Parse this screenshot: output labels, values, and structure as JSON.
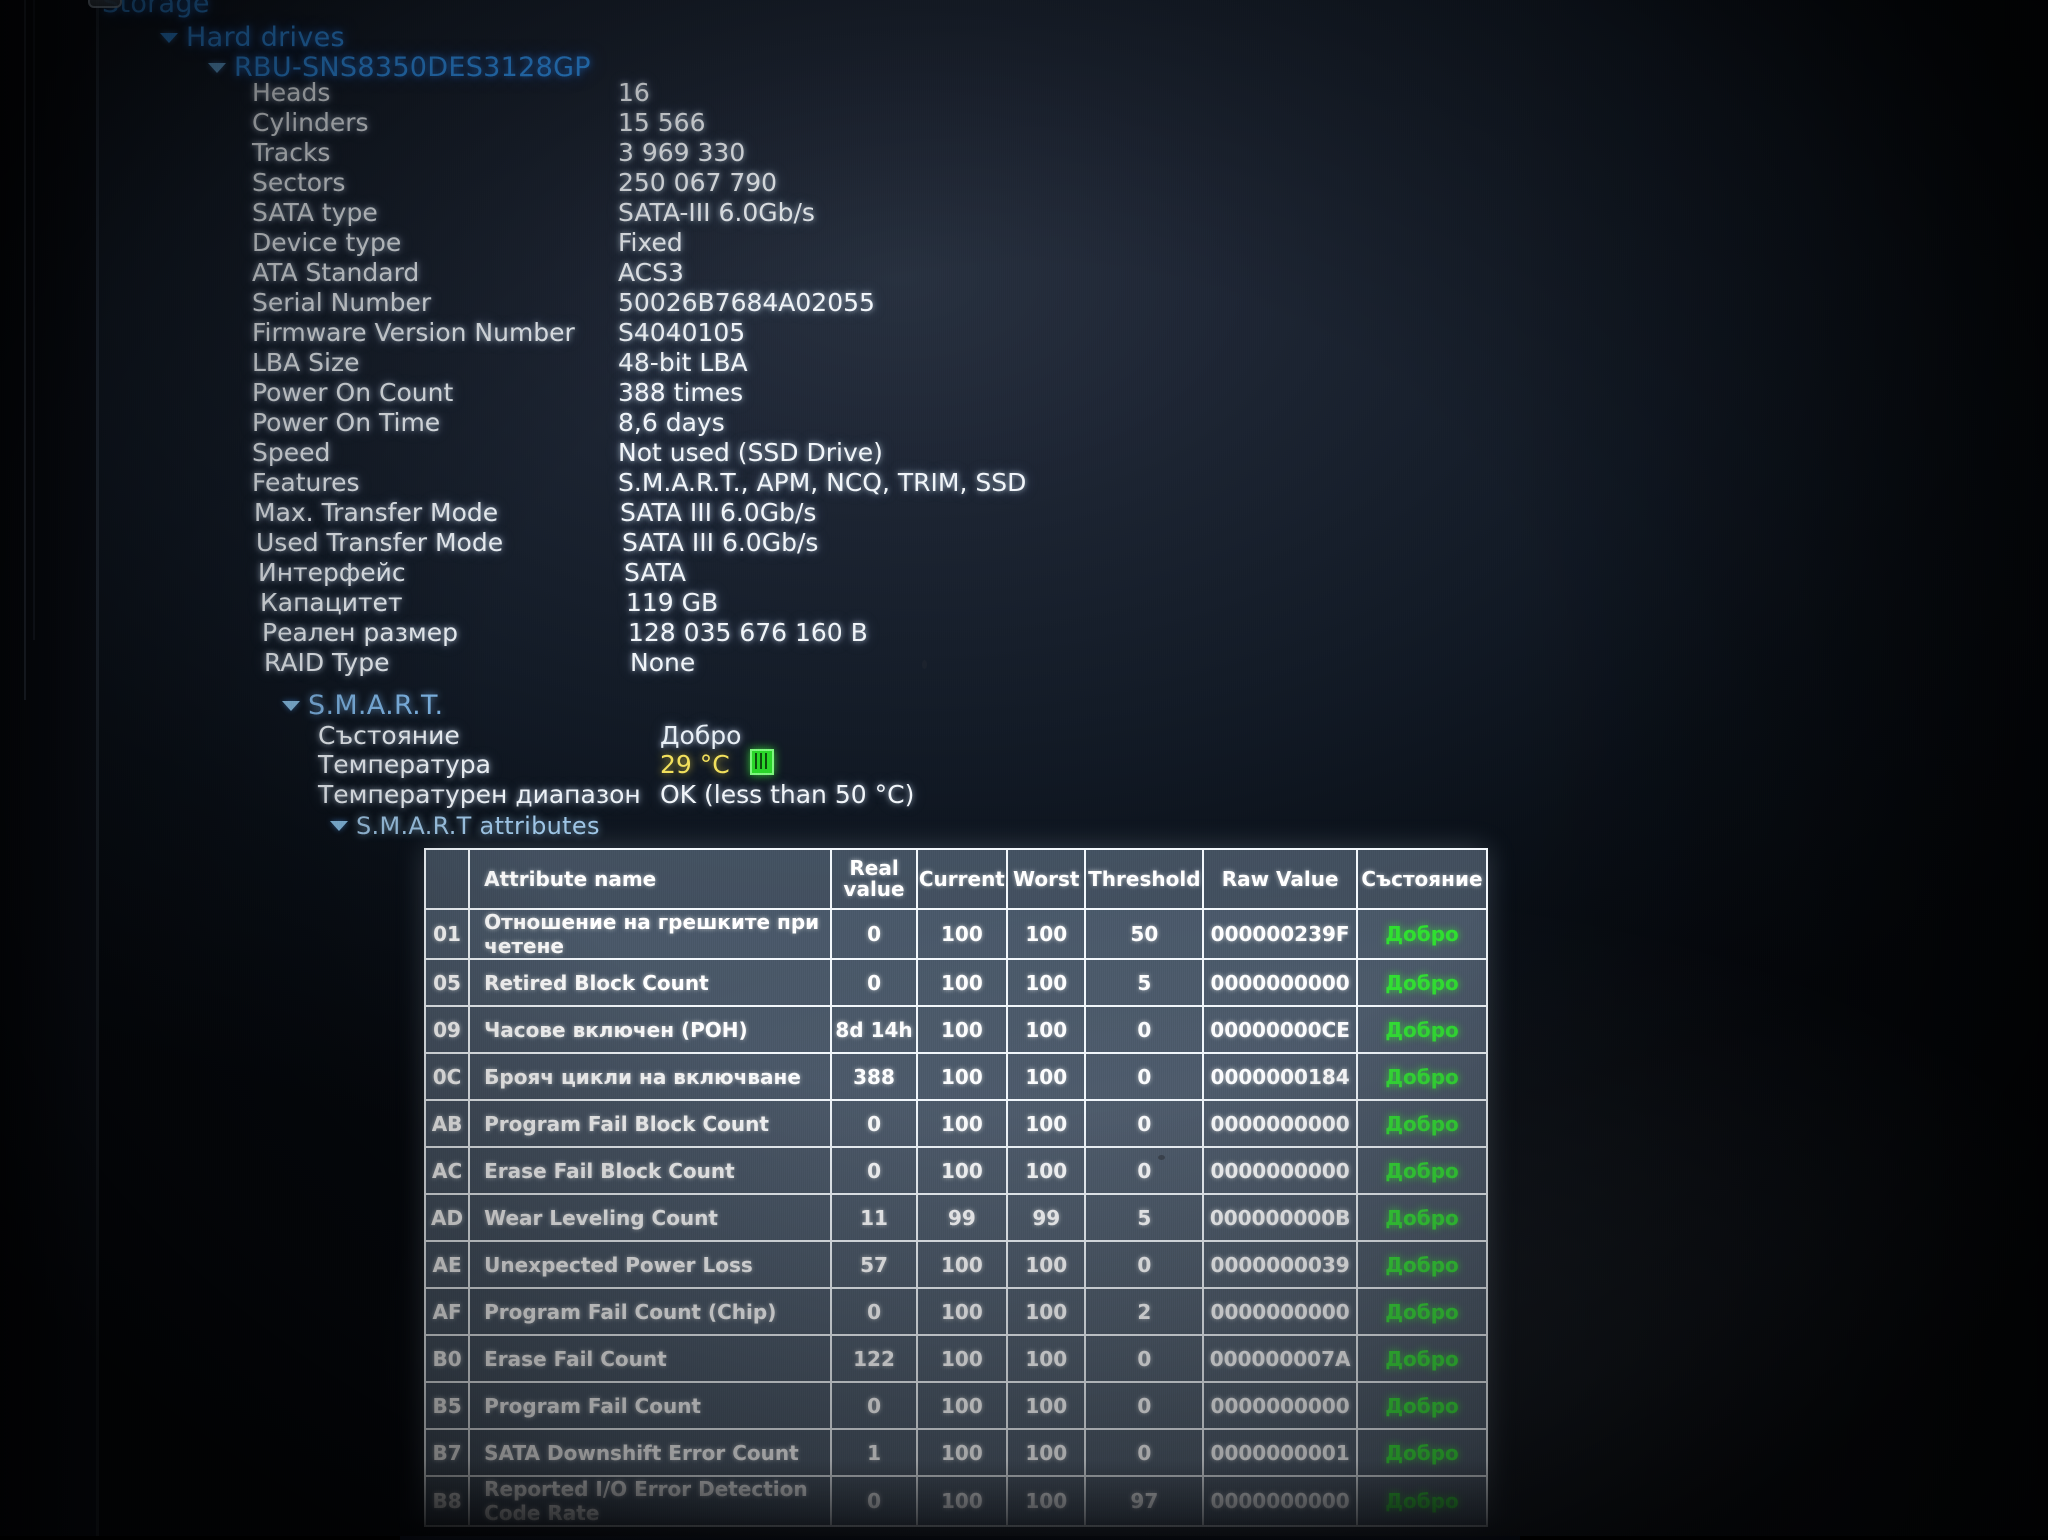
{
  "tree": {
    "root_label": "Storage",
    "root_icon": "hard-drive-icon",
    "hard_drives_label": "Hard drives",
    "device_label": "RBU-SNS8350DES3128GP",
    "smart_label": "S.M.A.R.T.",
    "smart_attributes_label": "S.M.A.R.T attributes"
  },
  "device_properties": [
    {
      "key": "Heads",
      "value": "16"
    },
    {
      "key": "Cylinders",
      "value": "15 566"
    },
    {
      "key": "Tracks",
      "value": "3 969 330"
    },
    {
      "key": "Sectors",
      "value": "250 067 790"
    },
    {
      "key": "SATA type",
      "value": "SATA-III 6.0Gb/s"
    },
    {
      "key": "Device type",
      "value": "Fixed"
    },
    {
      "key": "ATA Standard",
      "value": "ACS3"
    },
    {
      "key": "Serial Number",
      "value": "50026B7684A02055"
    },
    {
      "key": "Firmware Version Number",
      "value": "S4040105"
    },
    {
      "key": "LBA Size",
      "value": "48-bit LBA"
    },
    {
      "key": "Power On Count",
      "value": "388 times"
    },
    {
      "key": "Power On Time",
      "value": "8,6 days"
    },
    {
      "key": "Speed",
      "value": "Not used (SSD Drive)"
    },
    {
      "key": "Features",
      "value": "S.M.A.R.T., APM, NCQ, TRIM, SSD"
    },
    {
      "key": "Max. Transfer Mode",
      "value": "SATA III 6.0Gb/s"
    },
    {
      "key": "Used Transfer Mode",
      "value": "SATA III 6.0Gb/s"
    },
    {
      "key": "Интерфейс",
      "value": "SATA"
    },
    {
      "key": "Капацитет",
      "value": "119 GB"
    },
    {
      "key": "Реален размер",
      "value": "128 035 676 160 B"
    },
    {
      "key": "RAID Type",
      "value": "None"
    }
  ],
  "smart_summary": [
    {
      "key": "Състояние",
      "value": "Добро"
    },
    {
      "key": "Температура",
      "value": "29 °C"
    },
    {
      "key": "Температурен диапазон",
      "value": "OK (less than 50 °C)"
    }
  ],
  "smart_table": {
    "headers": {
      "id": "",
      "attribute_name": "Attribute name",
      "real_value": "Real value",
      "current": "Current",
      "worst": "Worst",
      "threshold": "Threshold",
      "raw_value": "Raw Value",
      "status": "Състояние"
    },
    "rows": [
      {
        "id": "01",
        "name": "Отношение на грешките при четене",
        "real": "0",
        "current": "100",
        "worst": "100",
        "threshold": "50",
        "raw": "000000239F",
        "status": "Добро"
      },
      {
        "id": "05",
        "name": "Retired Block Count",
        "real": "0",
        "current": "100",
        "worst": "100",
        "threshold": "5",
        "raw": "0000000000",
        "status": "Добро"
      },
      {
        "id": "09",
        "name": "Часове включен (POH)",
        "real": "8d 14h",
        "current": "100",
        "worst": "100",
        "threshold": "0",
        "raw": "00000000CE",
        "status": "Добро"
      },
      {
        "id": "0C",
        "name": "Брояч цикли на включване",
        "real": "388",
        "current": "100",
        "worst": "100",
        "threshold": "0",
        "raw": "0000000184",
        "status": "Добро"
      },
      {
        "id": "AB",
        "name": "Program Fail Block Count",
        "real": "0",
        "current": "100",
        "worst": "100",
        "threshold": "0",
        "raw": "0000000000",
        "status": "Добро"
      },
      {
        "id": "AC",
        "name": "Erase Fail Block Count",
        "real": "0",
        "current": "100",
        "worst": "100",
        "threshold": "0",
        "raw": "0000000000",
        "status": "Добро"
      },
      {
        "id": "AD",
        "name": "Wear Leveling Count",
        "real": "11",
        "current": "99",
        "worst": "99",
        "threshold": "5",
        "raw": "000000000B",
        "status": "Добро"
      },
      {
        "id": "AE",
        "name": "Unexpected Power Loss",
        "real": "57",
        "current": "100",
        "worst": "100",
        "threshold": "0",
        "raw": "0000000039",
        "status": "Добро"
      },
      {
        "id": "AF",
        "name": "Program Fail Count (Chip)",
        "real": "0",
        "current": "100",
        "worst": "100",
        "threshold": "2",
        "raw": "0000000000",
        "status": "Добро"
      },
      {
        "id": "B0",
        "name": "Erase Fail Count",
        "real": "122",
        "current": "100",
        "worst": "100",
        "threshold": "0",
        "raw": "000000007A",
        "status": "Добро"
      },
      {
        "id": "B5",
        "name": "Program Fail Count",
        "real": "0",
        "current": "100",
        "worst": "100",
        "threshold": "0",
        "raw": "0000000000",
        "status": "Добро"
      },
      {
        "id": "B7",
        "name": "SATA Downshift Error Count",
        "real": "1",
        "current": "100",
        "worst": "100",
        "threshold": "0",
        "raw": "0000000001",
        "status": "Добро"
      },
      {
        "id": "B8",
        "name": "Reported I/O Error Detection Code Rate",
        "real": "0",
        "current": "100",
        "worst": "100",
        "threshold": "97",
        "raw": "0000000000",
        "status": "Добро"
      }
    ]
  },
  "colors": {
    "tree_blue": "#2f8fe8",
    "value_white": "#f2f6fa",
    "temp_yellow": "#f2e05c",
    "status_green": "#2ee02e"
  }
}
